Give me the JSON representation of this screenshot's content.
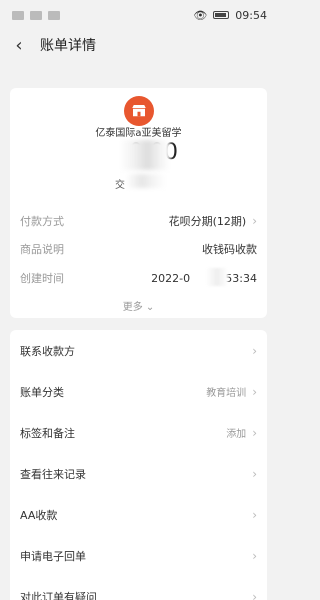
{
  "status_bar": {
    "time": "09:54"
  },
  "header": {
    "title": "账单详情"
  },
  "merchant": {
    "name": "亿泰国际a亚美留学",
    "amount": "0.00",
    "status": "交"
  },
  "details": [
    {
      "label": "付款方式",
      "value": "花呗分期(12期)"
    },
    {
      "label": "商品说明",
      "value": "收钱码收款"
    },
    {
      "label": "创建时间",
      "value": "2022-0     09:53:34"
    }
  ],
  "more_label": "更多",
  "list": [
    {
      "label": "联系收款方",
      "value": ""
    },
    {
      "label": "账单分类",
      "value": "教育培训"
    },
    {
      "label": "标签和备注",
      "value": "添加"
    },
    {
      "label": "查看往来记录",
      "value": ""
    },
    {
      "label": "AA收款",
      "value": ""
    },
    {
      "label": "申请电子回单",
      "value": ""
    },
    {
      "label": "对此订单有疑问",
      "value": ""
    }
  ]
}
